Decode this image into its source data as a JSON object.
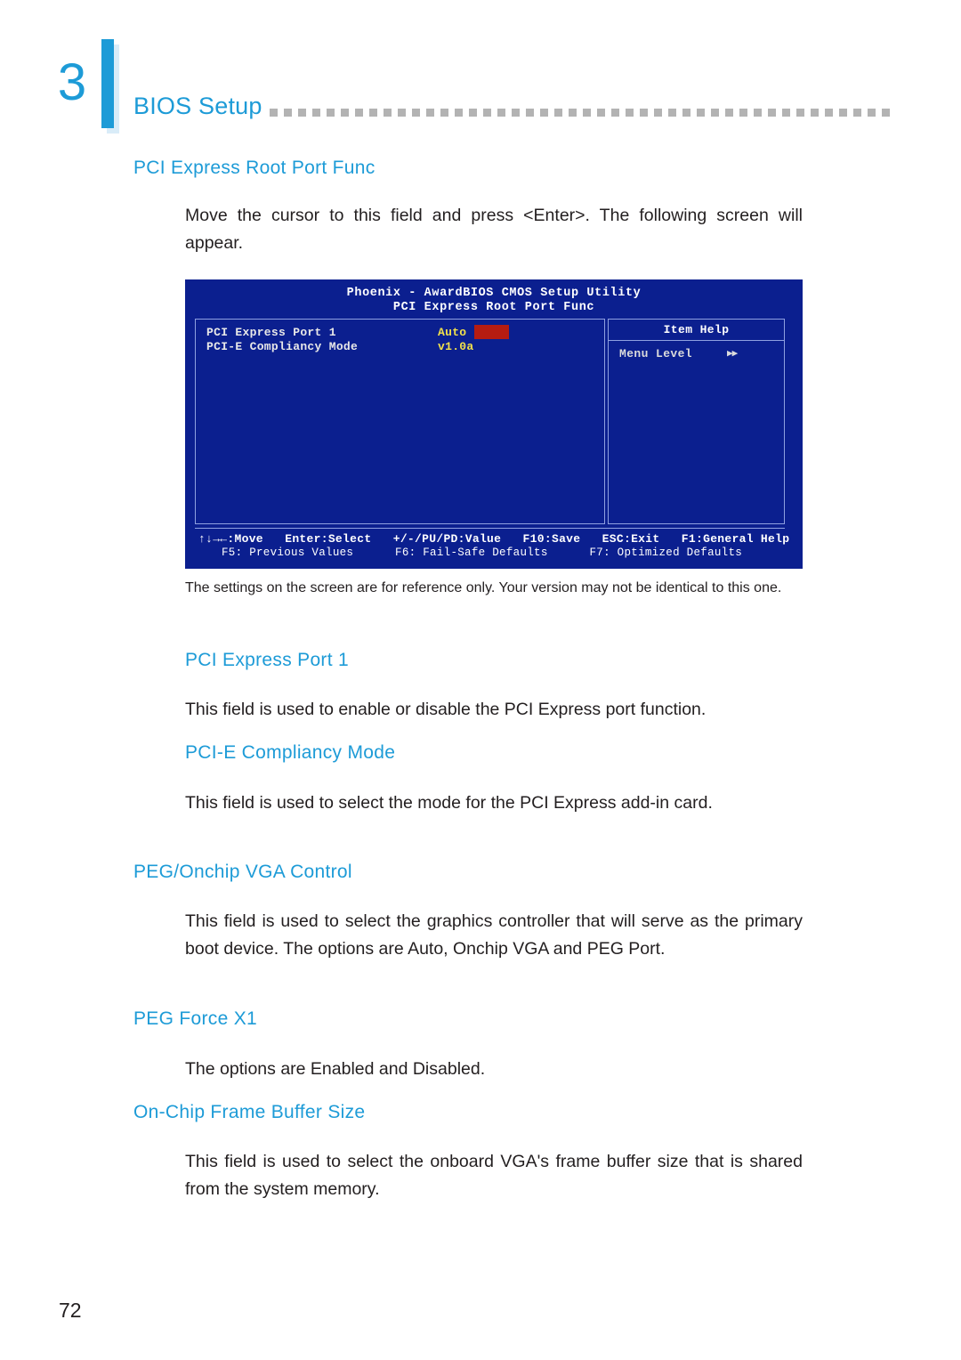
{
  "header": {
    "chapter_number": "3",
    "title": "BIOS Setup",
    "dot_count": 44
  },
  "sections": {
    "intro": {
      "title": "PCI Express Root Port Func",
      "body": "Move the cursor to this field and press <Enter>. The following screen will appear."
    },
    "caption": "The settings on the screen are for reference only. Your version may not be identical to this one.",
    "pci_express_port_1": {
      "title": "PCI Express Port 1",
      "body": "This field is used to enable or disable the PCI Express port function."
    },
    "pcie_compliancy_mode": {
      "title": "PCI-E Compliancy Mode",
      "body": "This field is used to select the mode for the PCI Express add-in card."
    },
    "peg_onchip_vga_control": {
      "title": "PEG/Onchip VGA Control",
      "body": "This field is used to select the graphics controller that will serve as the primary boot device. The options are Auto, Onchip VGA and PEG Port."
    },
    "peg_force_x1": {
      "title": "PEG Force X1",
      "body": "The options are Enabled and Disabled."
    },
    "onchip_frame_buffer_size": {
      "title": "On-Chip Frame Buffer Size",
      "body": "This field is used to select the onboard VGA's frame buffer size that is shared from the system memory."
    }
  },
  "bios_screen": {
    "title_line_1": "Phoenix - AwardBIOS CMOS Setup Utility",
    "title_line_2": "PCI Express Root Port Func",
    "items": [
      {
        "label": "PCI Express Port 1",
        "value": "Auto"
      },
      {
        "label": "PCI-E Compliancy Mode",
        "value": "v1.0a"
      }
    ],
    "help_panel": {
      "title": "Item Help",
      "menu_level_label": "Menu Level",
      "menu_level_arrows": "▶▶"
    },
    "footer_line_1": "↑↓→←:Move   Enter:Select   +/-/PU/PD:Value   F10:Save   ESC:Exit   F1:General Help",
    "footer_line_2": "F5: Previous Values      F6: Fail-Safe Defaults      F7: Optimized Defaults"
  },
  "footer": {
    "page_number": "72"
  },
  "colors": {
    "accent": "#1d9bd7",
    "bios_background": "#0b1f8f",
    "bios_value": "#f2e14b",
    "bios_cursor": "#b61c12"
  }
}
